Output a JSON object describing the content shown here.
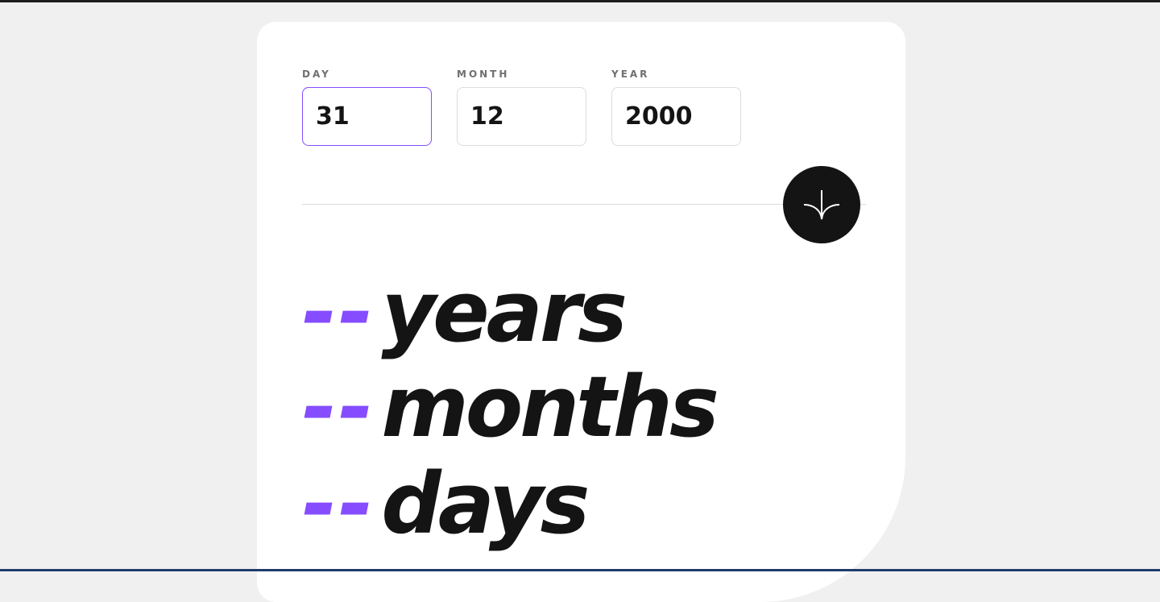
{
  "form": {
    "day": {
      "label": "DAY",
      "value": "31"
    },
    "month": {
      "label": "MONTH",
      "value": "12"
    },
    "year": {
      "label": "YEAR",
      "value": "2000"
    }
  },
  "submit_icon": "arrow-down-icon",
  "results": [
    {
      "value": "--",
      "unit": "years"
    },
    {
      "value": "--",
      "unit": "months"
    },
    {
      "value": "--",
      "unit": "days"
    }
  ],
  "colors": {
    "accent": "#854dff",
    "text": "#141414",
    "label": "#716f6f",
    "background": "#f0f0f0",
    "card": "#ffffff"
  }
}
